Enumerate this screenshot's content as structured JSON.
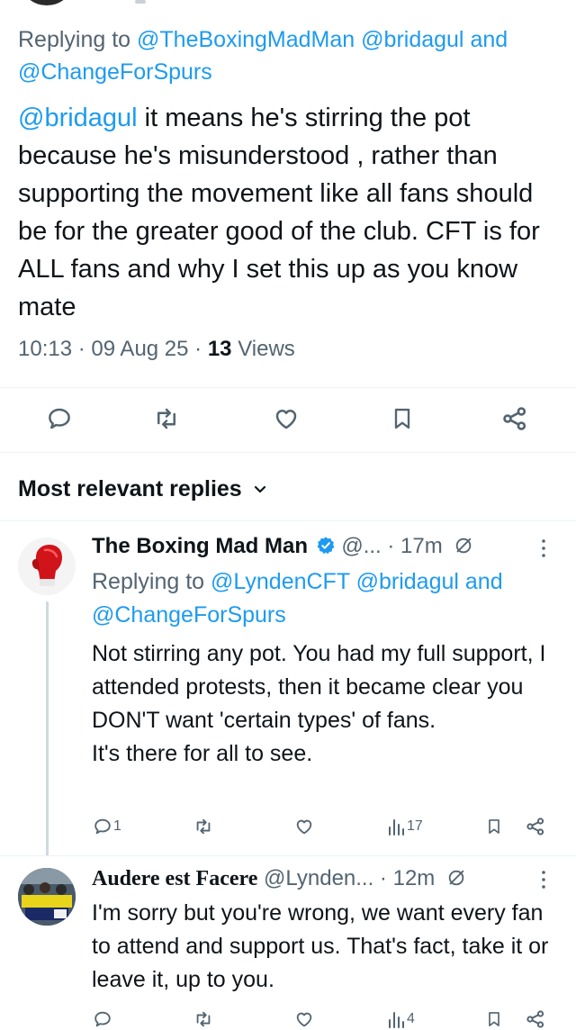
{
  "main_tweet": {
    "replying_prefix": "Replying to",
    "mention_1": "@TheBoxingMadMan",
    "mention_2": "@bridagul",
    "and_word": "and",
    "mention_3": "@ChangeForSpurs",
    "body_mention": "@bridagul",
    "body_text": " it means he's stirring the pot because he's misunderstood , rather than supporting the movement like all fans should be for the greater good of the club. CFT is for ALL fans and why I set this up as you know mate",
    "time": "10:13",
    "date": "09 Aug 25",
    "views_count": "13",
    "views_label": "Views"
  },
  "replies_header": {
    "label": "Most relevant replies"
  },
  "replies": [
    {
      "name": "The Boxing Mad Man",
      "handle": "@...",
      "age": "17m",
      "replying_prefix": "Replying to",
      "mention_1": "@LyndenCFT",
      "mention_2": "@bridagul",
      "and_word": "and",
      "mention_3": "@ChangeForSpurs",
      "body": "Not stirring any pot. You had my full support, I attended protests, then it became clear you DON'T want 'certain types' of fans.\nIt's there for all to see.",
      "reply_count": "1",
      "views_count": "17"
    },
    {
      "name": "Audere est Facere",
      "handle": "@Lynden...",
      "age": "12m",
      "body": "I'm sorry but you're wrong, we want every fan to attend and support us. That's fact, take it or leave it, up to you.",
      "views_count": "4"
    }
  ],
  "colors": {
    "accent": "#1d9bf0",
    "muted": "#536471",
    "divider": "#eff3f4"
  }
}
